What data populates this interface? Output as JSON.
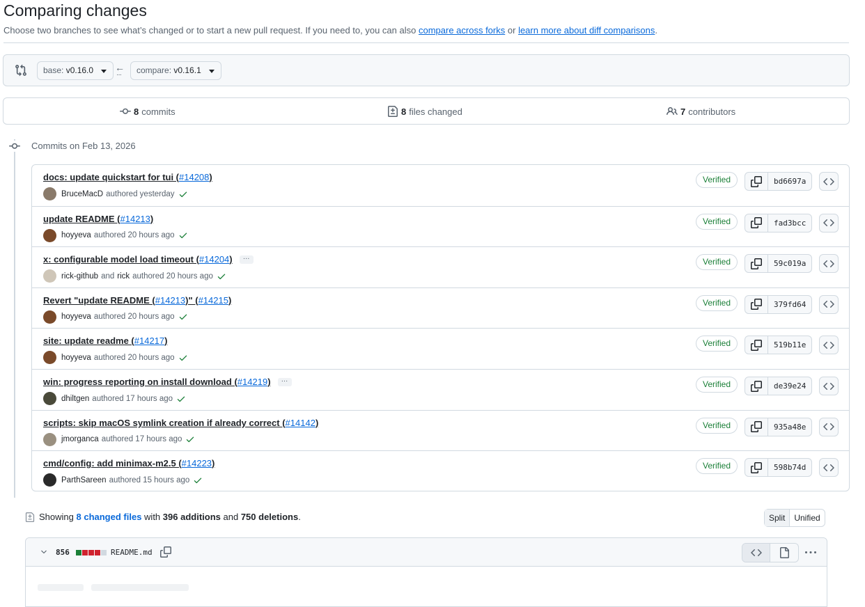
{
  "page": {
    "title": "Comparing changes",
    "subtitle_text": "Choose two branches to see what’s changed or to start a new pull request. If you need to, you can also",
    "link_forks": "compare across forks",
    "subtitle_or": "or",
    "link_learn": "learn more about diff comparisons",
    "subtitle_end": "."
  },
  "range": {
    "base_label": "base:",
    "base_value": "v0.16.0",
    "compare_label": "compare:",
    "compare_value": "v0.16.1",
    "arrow": "←",
    "dots": "···"
  },
  "summary": {
    "commits_count": "8",
    "commits_label": "commits",
    "files_count": "8",
    "files_label": "files changed",
    "contributors_count": "7",
    "contributors_label": "contributors"
  },
  "timeline": {
    "date_label": "Commits on Feb 13, 2026"
  },
  "commits": [
    {
      "message": "docs: update quickstart for tui (",
      "pr": "#14208",
      "close": ")",
      "more": false,
      "author": "BruceMacD",
      "coauthor": "",
      "time": "authored yesterday",
      "sha": "bd6697a",
      "verified": "Verified",
      "avatar_color": "#8a7a6a"
    },
    {
      "message": "update README (",
      "pr": "#14213",
      "close": ")",
      "more": false,
      "author": "hoyyeva",
      "coauthor": "",
      "time": "authored 20 hours ago",
      "sha": "fad3bcc",
      "verified": "Verified",
      "avatar_color": "#7a4a2a"
    },
    {
      "message": "x: configurable model load timeout (",
      "pr": "#14204",
      "close": ")",
      "more": true,
      "author": "rick-github",
      "and": "and",
      "coauthor": "rick",
      "time": "authored 20 hours ago",
      "sha": "59c019a",
      "verified": "Verified",
      "avatar_color": "#cfc6b8"
    },
    {
      "message": "Revert \"update README (",
      "pr": "#14213",
      "mid": ")\" (",
      "pr2": "#14215",
      "close": ")",
      "more": false,
      "author": "hoyyeva",
      "coauthor": "",
      "time": "authored 20 hours ago",
      "sha": "379fd64",
      "verified": "Verified",
      "avatar_color": "#7a4a2a"
    },
    {
      "message": "site: update readme (",
      "pr": "#14217",
      "close": ")",
      "more": false,
      "author": "hoyyeva",
      "coauthor": "",
      "time": "authored 20 hours ago",
      "sha": "519b11e",
      "verified": "Verified",
      "avatar_color": "#7a4a2a"
    },
    {
      "message": "win: progress reporting on install download (",
      "pr": "#14219",
      "close": ")",
      "more": true,
      "author": "dhiltgen",
      "coauthor": "",
      "time": "authored 17 hours ago",
      "sha": "de39e24",
      "verified": "Verified",
      "avatar_color": "#4a4a3a"
    },
    {
      "message": "scripts: skip macOS symlink creation if already correct (",
      "pr": "#14142",
      "close": ")",
      "more": false,
      "author": "jmorganca",
      "coauthor": "",
      "time": "authored 17 hours ago",
      "sha": "935a48e",
      "verified": "Verified",
      "avatar_color": "#9a9080"
    },
    {
      "message": "cmd/config: add minimax-m2.5 (",
      "pr": "#14223",
      "close": ")",
      "more": false,
      "author": "ParthSareen",
      "coauthor": "",
      "time": "authored 15 hours ago",
      "sha": "598b74d",
      "verified": "Verified",
      "avatar_color": "#2a2a2a"
    }
  ],
  "files_summary": {
    "showing": "Showing",
    "changed_files": "8 changed files",
    "with": "with",
    "additions": "396 additions",
    "and": "and",
    "deletions": "750 deletions",
    "end": "."
  },
  "view_toggle": {
    "split": "Split",
    "unified": "Unified"
  },
  "file": {
    "changes": "856",
    "name": "README.md",
    "diffbar": [
      "#1a7f37",
      "#cf222e",
      "#cf222e",
      "#cf222e",
      "#d1d9e0"
    ]
  },
  "colors": {
    "accent": "#0969da",
    "success": "#1a7f37",
    "danger": "#cf222e",
    "border": "#d1d9e0"
  }
}
